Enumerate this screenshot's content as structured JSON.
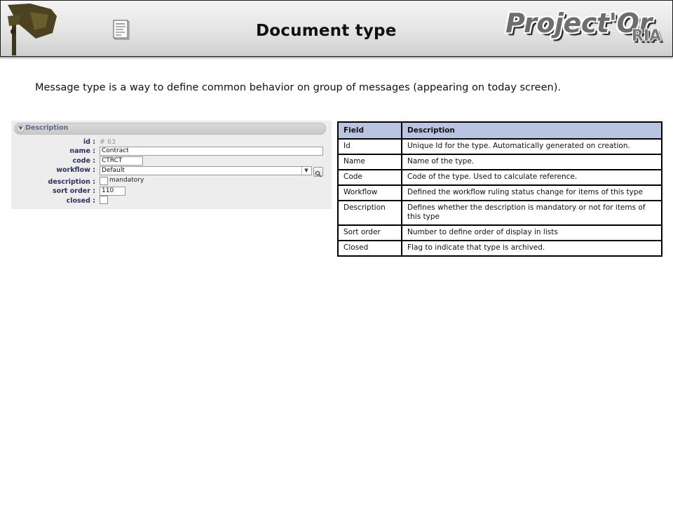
{
  "header": {
    "title": "Document type",
    "brand": "Project'Or",
    "brand_suffix": "RIA",
    "left_logo_icon": "spotlight-logo-icon",
    "doc_icon": "document-icon"
  },
  "intro_text": "Message type is a way to define common behavior on group of messages (appearing on today screen).",
  "form": {
    "section_title": "Description",
    "id_label": "id :",
    "id_value": "# 63",
    "name_label": "name :",
    "name_value": "Contract",
    "code_label": "code :",
    "code_value": "CTRCT",
    "workflow_label": "workflow :",
    "workflow_value": "Default",
    "description_label": "description :",
    "mandatory_label": "mandatory",
    "sort_order_label": "sort order :",
    "sort_order_value": "110",
    "closed_label": "closed :"
  },
  "table": {
    "headers": [
      "Field",
      "Description"
    ],
    "rows": [
      [
        "Id",
        "Unique Id for the type. Automatically generated on creation."
      ],
      [
        "Name",
        "Name of the type."
      ],
      [
        "Code",
        "Code of the type. Used to calculate reference."
      ],
      [
        "Workflow",
        "Defined the workflow ruling status change for items of this type"
      ],
      [
        "Description",
        "Defines whether the description is mandatory or not for items of this type"
      ],
      [
        "Sort order",
        "Number to define order of display in lists"
      ],
      [
        "Closed",
        "Flag to indicate that type is archived."
      ]
    ]
  },
  "colors": {
    "table_header": "#b9c3e2",
    "form_label": "#2f2f5a",
    "section_title": "#5b6b8a"
  }
}
